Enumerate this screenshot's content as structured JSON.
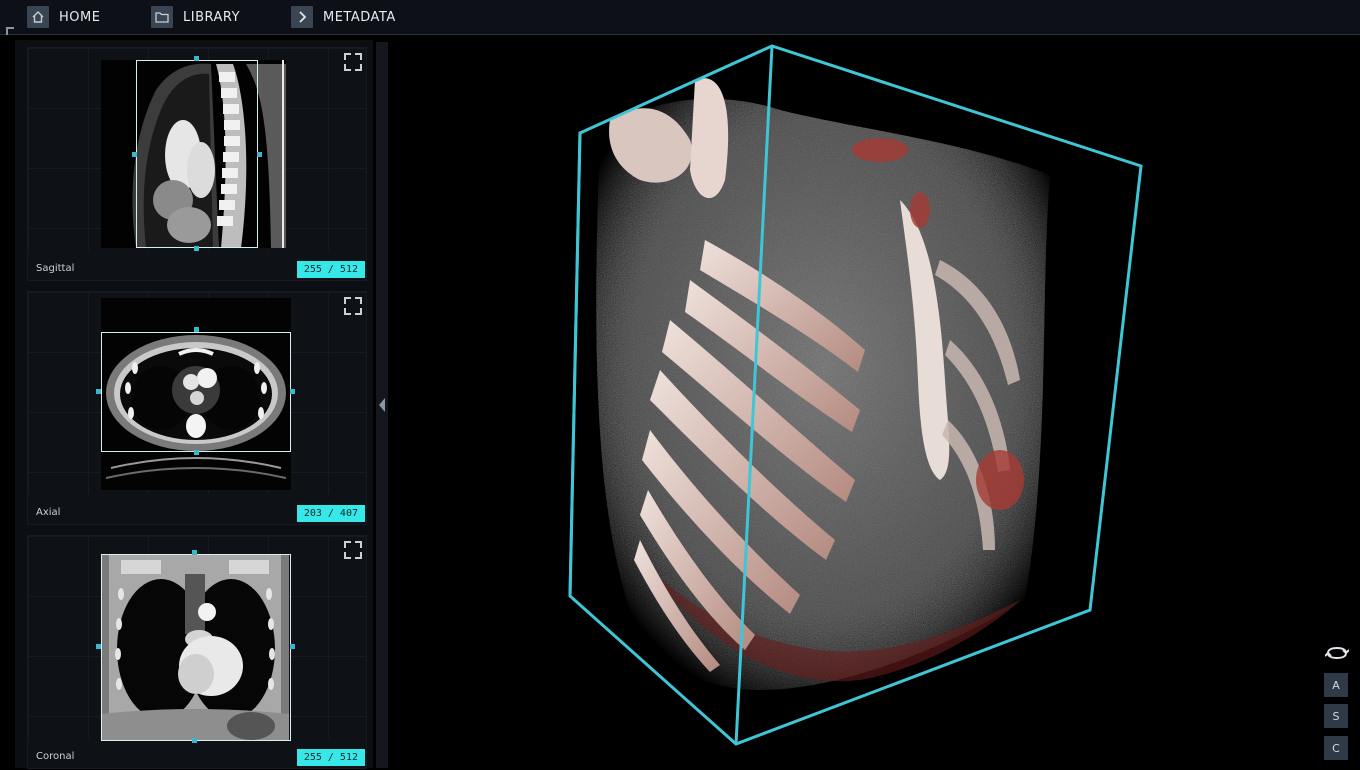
{
  "nav": {
    "home": "HOME",
    "library": "LIBRARY",
    "metadata": "METADATA"
  },
  "views": [
    {
      "label": "Sagittal",
      "slice": "255 / 512"
    },
    {
      "label": "Axial",
      "slice": "203 / 407"
    },
    {
      "label": "Coronal",
      "slice": "255 / 512"
    }
  ],
  "controls": {
    "a": "A",
    "s": "S",
    "c": "C"
  },
  "colors": {
    "accent": "#38e8e8",
    "bbox": "#3fc6d6",
    "panel": "#0b0e12",
    "nav_bg": "#0d1117"
  },
  "icons": [
    "home-icon",
    "folder-icon",
    "chevron-right-icon",
    "expand-icon",
    "rotate-icon",
    "collapse-arrow-icon"
  ]
}
